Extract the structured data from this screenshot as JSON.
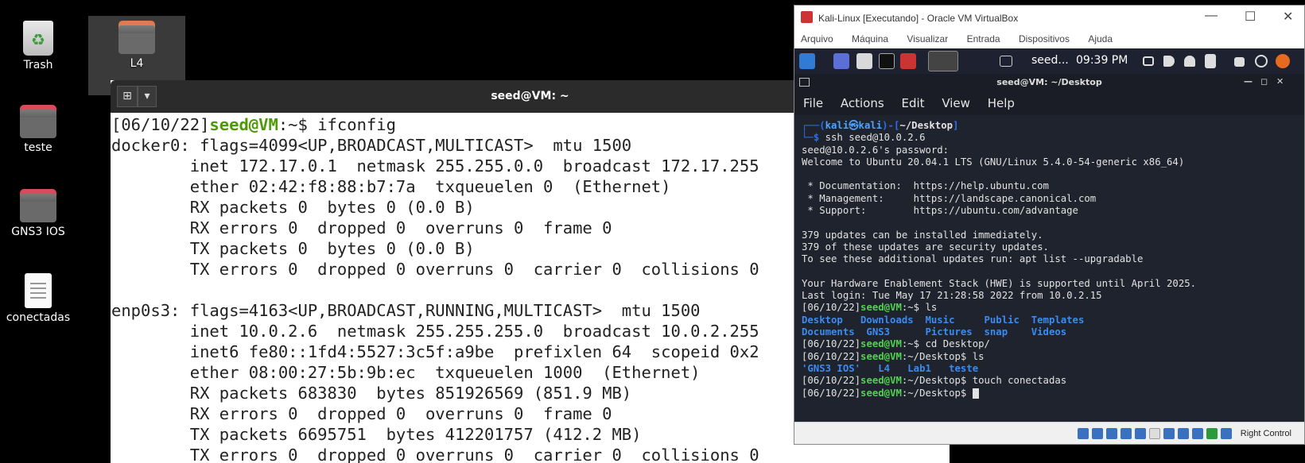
{
  "desktop": {
    "icons": [
      {
        "label": "Trash"
      },
      {
        "label": "L4"
      },
      {
        "label": "teste"
      },
      {
        "label": "GNS3 IOS"
      },
      {
        "label": "conectadas"
      }
    ]
  },
  "terminal_left": {
    "title": "seed@VM: ~",
    "new_tab_icon": "new-tab-icon",
    "prompt_date": "[06/10/22]",
    "prompt_user": "seed@VM",
    "prompt_path": ":~$ ",
    "command": "ifconfig",
    "lines": [
      "docker0: flags=4099<UP,BROADCAST,MULTICAST>  mtu 1500",
      "        inet 172.17.0.1  netmask 255.255.0.0  broadcast 172.17.255",
      "        ether 02:42:f8:88:b7:7a  txqueuelen 0  (Ethernet)",
      "        RX packets 0  bytes 0 (0.0 B)",
      "        RX errors 0  dropped 0  overruns 0  frame 0",
      "        TX packets 0  bytes 0 (0.0 B)",
      "        TX errors 0  dropped 0 overruns 0  carrier 0  collisions 0",
      "",
      "enp0s3: flags=4163<UP,BROADCAST,RUNNING,MULTICAST>  mtu 1500",
      "        inet 10.0.2.6  netmask 255.255.255.0  broadcast 10.0.2.255",
      "        inet6 fe80::1fd4:5527:3c5f:a9be  prefixlen 64  scopeid 0x2",
      "        ether 08:00:27:5b:9b:ec  txqueuelen 1000  (Ethernet)",
      "        RX packets 683830  bytes 851926569 (851.9 MB)",
      "        RX errors 0  dropped 0  overruns 0  frame 0",
      "        TX packets 6695751  bytes 412201757 (412.2 MB)",
      "        TX errors 0  dropped 0 overruns 0  carrier 0  collisions 0"
    ]
  },
  "vbox": {
    "title": "Kali-Linux [Executando] - Oracle VM VirtualBox",
    "menu": [
      "Arquivo",
      "Máquina",
      "Visualizar",
      "Entrada",
      "Dispositivos",
      "Ajuda"
    ],
    "status_right": "Right Control"
  },
  "kali_panel": {
    "task": "seed...",
    "clock": "09:39 PM"
  },
  "kali_terminal": {
    "title": "seed@VM: ~/Desktop",
    "menu": [
      "File",
      "Actions",
      "Edit",
      "View",
      "Help"
    ],
    "prompt_head_open": "┌──(",
    "prompt_user": "kali㉿kali",
    "prompt_mid": ")-[",
    "prompt_dir": "~/Desktop",
    "prompt_close": "]",
    "prompt_tail": "└─$ ",
    "ssh_cmd": "ssh seed@10.0.2.6",
    "output": [
      "seed@10.0.2.6's password:",
      "Welcome to Ubuntu 20.04.1 LTS (GNU/Linux 5.4.0-54-generic x86_64)",
      "",
      " * Documentation:  https://help.ubuntu.com",
      " * Management:     https://landscape.canonical.com",
      " * Support:        https://ubuntu.com/advantage",
      "",
      "379 updates can be installed immediately.",
      "379 of these updates are security updates.",
      "To see these additional updates run: apt list --upgradable",
      "",
      "Your Hardware Enablement Stack (HWE) is supported until April 2025.",
      "Last login: Tue May 17 21:28:58 2022 from 10.0.2.15"
    ],
    "p_date": "[06/10/22]",
    "p_user": "seed@VM",
    "p_home": ":~$ ",
    "p_desk": ":~/Desktop$ ",
    "cmd_ls": "ls",
    "ls_row1": "Desktop   Downloads  Music     Public  Templates",
    "ls_row2": "Documents  GNS3      Pictures  snap    Videos",
    "cmd_cd": "cd Desktop/",
    "ls2": "'GNS3 IOS'   L4   Lab1   teste",
    "cmd_touch": "touch conectadas"
  }
}
